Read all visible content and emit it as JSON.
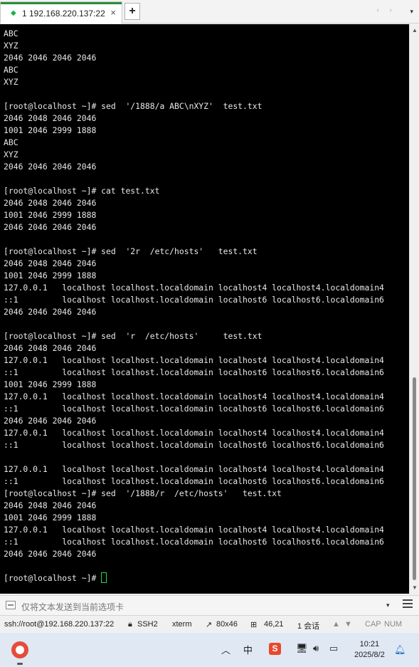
{
  "tabbar": {
    "tab_label": "1 192.168.220.137:22",
    "close_glyph": "×",
    "newtab_glyph": "+",
    "nav_glyphs": "‹ ›",
    "menu_glyph": "▾"
  },
  "terminal": {
    "lines": [
      "ABC",
      "XYZ",
      "2046 2046 2046 2046",
      "ABC",
      "XYZ",
      "",
      "[root@localhost ~]# sed  '/1888/a ABC\\nXYZ'  test.txt",
      "2046 2048 2046 2046",
      "1001 2046 2999 1888",
      "ABC",
      "XYZ",
      "2046 2046 2046 2046",
      "",
      "[root@localhost ~]# cat test.txt",
      "2046 2048 2046 2046",
      "1001 2046 2999 1888",
      "2046 2046 2046 2046",
      "",
      "[root@localhost ~]# sed  '2r  /etc/hosts'   test.txt",
      "2046 2048 2046 2046",
      "1001 2046 2999 1888",
      "127.0.0.1   localhost localhost.localdomain localhost4 localhost4.localdomain4",
      "::1         localhost localhost.localdomain localhost6 localhost6.localdomain6",
      "2046 2046 2046 2046",
      "",
      "[root@localhost ~]# sed  'r  /etc/hosts'     test.txt",
      "2046 2048 2046 2046",
      "127.0.0.1   localhost localhost.localdomain localhost4 localhost4.localdomain4",
      "::1         localhost localhost.localdomain localhost6 localhost6.localdomain6",
      "1001 2046 2999 1888",
      "127.0.0.1   localhost localhost.localdomain localhost4 localhost4.localdomain4",
      "::1         localhost localhost.localdomain localhost6 localhost6.localdomain6",
      "2046 2046 2046 2046",
      "127.0.0.1   localhost localhost.localdomain localhost4 localhost4.localdomain4",
      "::1         localhost localhost.localdomain localhost6 localhost6.localdomain6",
      "",
      "127.0.0.1   localhost localhost.localdomain localhost4 localhost4.localdomain4",
      "::1         localhost localhost.localdomain localhost6 localhost6.localdomain6",
      "[root@localhost ~]# sed  '/1888/r  /etc/hosts'   test.txt",
      "2046 2048 2046 2046",
      "1001 2046 2999 1888",
      "127.0.0.1   localhost localhost.localdomain localhost4 localhost4.localdomain4",
      "::1         localhost localhost.localdomain localhost6 localhost6.localdomain6",
      "2046 2046 2046 2046",
      ""
    ],
    "prompt": "[root@localhost ~]# "
  },
  "sendbar": {
    "placeholder": "仅将文本发送到当前选项卡",
    "dropdown_glyph": "▾"
  },
  "statusbar": {
    "connection": "ssh://root@192.168.220.137:22",
    "protocol": "SSH2",
    "terminal_type": "xterm",
    "size": "80x46",
    "cursor_pos": "46,21",
    "sessions": "1 会话",
    "caps": "CAP",
    "num": "NUM"
  },
  "taskbar": {
    "time": "10:21",
    "date": "2025/8/2",
    "ime_char": "中",
    "sogou_char": "S"
  }
}
